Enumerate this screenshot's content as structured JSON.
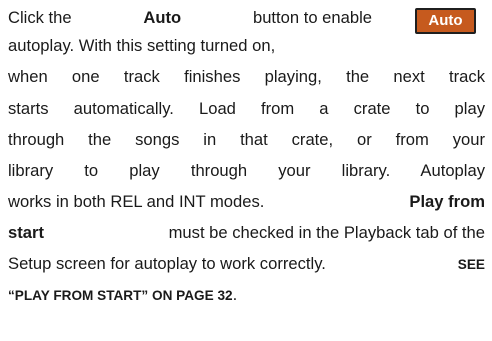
{
  "badge": {
    "label": "Auto",
    "color": "#c65a1e"
  },
  "text": {
    "l1_a": "Click the",
    "l1_b": "Auto",
    "l1_c": "button to enable",
    "l2": "autoplay. With this setting turned on,",
    "l3": "when one track finishes playing, the next track",
    "l4": "starts automatically. Load from a crate to play",
    "l5": "through the songs in that crate, or from your",
    "l6": "library to play through your library. Autoplay",
    "l7_a": "works in both REL and INT modes.",
    "l7_b": "Play from",
    "l8_a": "start",
    "l8_b": "must be checked in the Playback tab of the",
    "l9_a": "Setup screen for autoplay to work correctly.",
    "l9_b": "SEE",
    "l10_a": "“PLAY FROM START” ON PAGE 32",
    "l10_b": "."
  }
}
